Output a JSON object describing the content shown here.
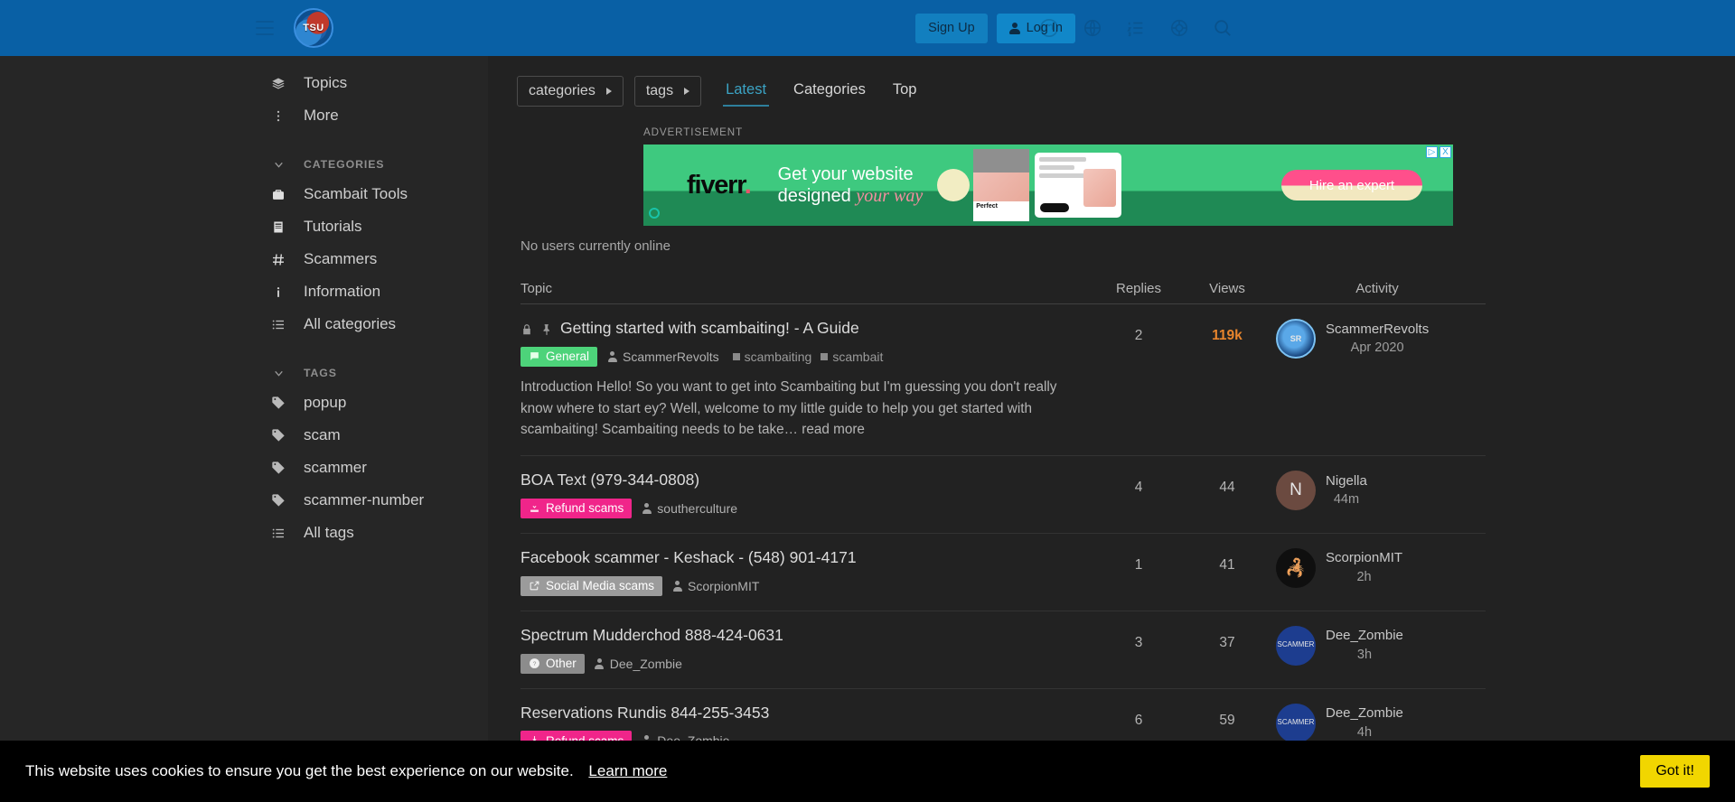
{
  "header": {
    "logo_text": "TSU",
    "signup_label": "Sign Up",
    "login_label": "Log In",
    "icons": [
      "hamburger-icon",
      "mastodon-icon",
      "globe-icon",
      "list-numbered-icon",
      "help-circle-icon",
      "search-icon"
    ],
    "brand_color": "#0960a5"
  },
  "sidebar": {
    "primary": [
      {
        "label": "Topics",
        "icon": "layers-icon"
      },
      {
        "label": "More",
        "icon": "dots-vertical-icon"
      }
    ],
    "categories_heading": "CATEGORIES",
    "categories": [
      {
        "label": "Scambait Tools",
        "icon": "toolbox-icon"
      },
      {
        "label": "Tutorials",
        "icon": "book-icon"
      },
      {
        "label": "Scammers",
        "icon": "hash-icon"
      },
      {
        "label": "Information",
        "icon": "info-icon"
      },
      {
        "label": "All categories",
        "icon": "list-icon"
      }
    ],
    "tags_heading": "TAGS",
    "tags": [
      {
        "label": "popup",
        "icon": "tag-icon"
      },
      {
        "label": "scam",
        "icon": "tag-icon"
      },
      {
        "label": "scammer",
        "icon": "tag-icon"
      },
      {
        "label": "scammer-number",
        "icon": "tag-icon"
      },
      {
        "label": "All tags",
        "icon": "list-icon"
      }
    ]
  },
  "nav": {
    "categories_dropdown": "categories",
    "tags_dropdown": "tags",
    "tabs": [
      {
        "label": "Latest",
        "active": true
      },
      {
        "label": "Categories",
        "active": false
      },
      {
        "label": "Top",
        "active": false
      }
    ]
  },
  "advertisement": {
    "label": "ADVERTISEMENT",
    "brand": "fiverr",
    "line1": "Get your website",
    "line2_plain": "designed ",
    "line2_italic": "your way",
    "cta": "Hire an expert",
    "card1_caption": "Perfect",
    "close_label": "X",
    "adchoices_label": "▷"
  },
  "online_status": "No users currently online",
  "table": {
    "columns": {
      "topic": "Topic",
      "replies": "Replies",
      "views": "Views",
      "activity": "Activity"
    },
    "rows": [
      {
        "title": "Getting started with scambaiting! - A Guide",
        "locked": true,
        "pinned": true,
        "category": {
          "label": "General",
          "color": "#4dd37a",
          "style": "general"
        },
        "author": "ScammerRevolts",
        "tags": [
          "scambaiting",
          "scambait"
        ],
        "excerpt": "Introduction Hello! So you want to get into Scambaiting but I'm guessing you don't really know where to start ey? Well, welcome to my little guide to help you get started with scambaiting! Scambaiting needs to be take…",
        "read_more": "read more",
        "replies": "2",
        "views": "119k",
        "views_hot": true,
        "activity_user": "ScammerRevolts",
        "activity_time": "Apr 2020",
        "avatar_text": "SR",
        "avatar_style": "av-sr"
      },
      {
        "title": "BOA Text (979-344-0808)",
        "locked": false,
        "pinned": false,
        "category": {
          "label": "Refund scams",
          "color": "#f0258a",
          "style": "refund"
        },
        "author": "southerculture",
        "tags": [],
        "excerpt": "",
        "read_more": "",
        "replies": "4",
        "views": "44",
        "views_hot": false,
        "activity_user": "Nigella",
        "activity_time": "44m",
        "avatar_text": "N",
        "avatar_style": "av-n"
      },
      {
        "title": "Facebook scammer - Keshack - (548) 901-4171",
        "locked": false,
        "pinned": false,
        "category": {
          "label": "Social Media scams",
          "color": "#9b9b9b",
          "style": "social"
        },
        "author": "ScorpionMIT",
        "tags": [],
        "excerpt": "",
        "read_more": "",
        "replies": "1",
        "views": "41",
        "views_hot": false,
        "activity_user": "ScorpionMIT",
        "activity_time": "2h",
        "avatar_text": "🦂",
        "avatar_style": "av-sc"
      },
      {
        "title": "Spectrum Mudderchod 888-424-0631",
        "locked": false,
        "pinned": false,
        "category": {
          "label": "Other",
          "color": "#8c8c8c",
          "style": "other"
        },
        "author": "Dee_Zombie",
        "tags": [],
        "excerpt": "",
        "read_more": "",
        "replies": "3",
        "views": "37",
        "views_hot": false,
        "activity_user": "Dee_Zombie",
        "activity_time": "3h",
        "avatar_text": "SCAMMER",
        "avatar_style": "av-dz"
      },
      {
        "title": "Reservations Rundis 844-255-3453",
        "locked": false,
        "pinned": false,
        "category": {
          "label": "Refund scams",
          "color": "#f0258a",
          "style": "refund"
        },
        "author": "Dee_Zombie",
        "tags": [],
        "excerpt": "",
        "read_more": "",
        "replies": "6",
        "views": "59",
        "views_hot": false,
        "activity_user": "Dee_Zombie",
        "activity_time": "4h",
        "avatar_text": "SCAMMER",
        "avatar_style": "av-dz"
      }
    ]
  },
  "cookie_banner": {
    "message": "This website uses cookies to ensure you get the best experience on our website.",
    "link": "Learn more",
    "button": "Got it!",
    "button_color": "#f1d600"
  }
}
